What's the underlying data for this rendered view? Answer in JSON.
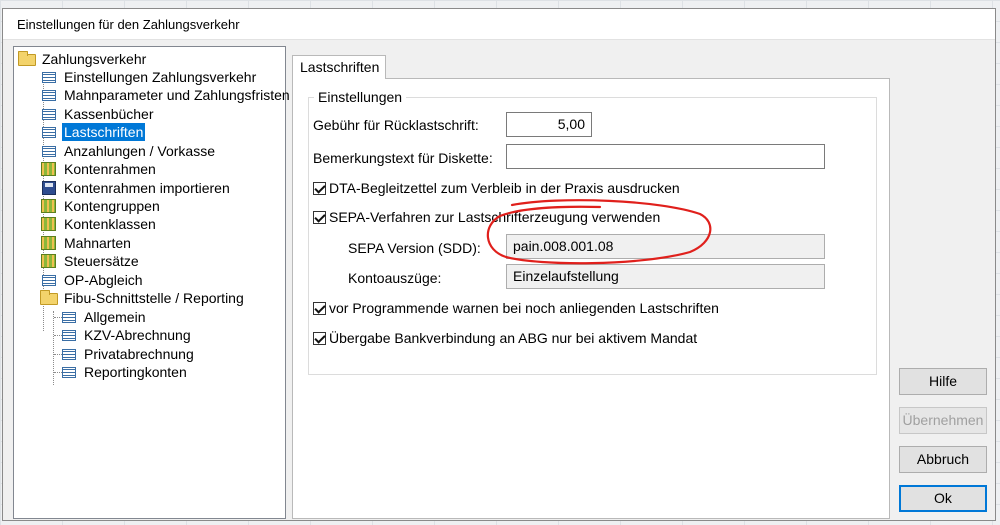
{
  "window": {
    "title": "Einstellungen für den Zahlungsverkehr"
  },
  "tree": {
    "root": "Zahlungsverkehr",
    "items": [
      {
        "label": "Einstellungen Zahlungsverkehr",
        "icon": "list-icon"
      },
      {
        "label": "Mahnparameter und Zahlungsfristen",
        "icon": "list-icon"
      },
      {
        "label": "Kassenbücher",
        "icon": "list-icon"
      },
      {
        "label": "Lastschriften",
        "icon": "list-icon",
        "selected": true
      },
      {
        "label": "Anzahlungen / Vorkasse",
        "icon": "list-icon"
      },
      {
        "label": "Kontenrahmen",
        "icon": "books-icon"
      },
      {
        "label": "Kontenrahmen importieren",
        "icon": "disk-icon"
      },
      {
        "label": "Kontengruppen",
        "icon": "books-icon"
      },
      {
        "label": "Kontenklassen",
        "icon": "books-icon"
      },
      {
        "label": "Mahnarten",
        "icon": "books-icon"
      },
      {
        "label": "Steuersätze",
        "icon": "books-icon"
      },
      {
        "label": "OP-Abgleich",
        "icon": "list-icon"
      },
      {
        "label": "Fibu-Schnittstelle / Reporting",
        "icon": "folder-open-icon"
      }
    ],
    "sub_items": [
      {
        "label": "Allgemein"
      },
      {
        "label": "KZV-Abrechnung"
      },
      {
        "label": "Privatabrechnung"
      },
      {
        "label": "Reportingkonten"
      }
    ]
  },
  "tab": {
    "label": "Lastschriften"
  },
  "group": {
    "legend": "Einstellungen"
  },
  "form": {
    "fee_label": "Gebühr für Rücklastschrift:",
    "fee_value": "5,00",
    "remark_label": "Bemerkungstext für Diskette:",
    "remark_value": "",
    "dta_label": "DTA-Begleitzettel zum Verbleib in der Praxis ausdrucken",
    "dta_checked": true,
    "sepa_label": "SEPA-Verfahren zur Lastschrifterzeugung verwenden",
    "sepa_checked": true,
    "sepa_version_label": "SEPA Version (SDD):",
    "sepa_version_value": "pain.008.001.08",
    "statement_label": "Kontoauszüge:",
    "statement_value": "Einzelaufstellung",
    "warn_label": "vor Programmende warnen bei noch anliegenden Lastschriften",
    "warn_checked": true,
    "transfer_label": "Übergabe Bankverbindung an ABG nur bei aktivem Mandat",
    "transfer_checked": true
  },
  "buttons": {
    "help": "Hilfe",
    "apply": "Übernehmen",
    "cancel": "Abbruch",
    "ok": "Ok"
  },
  "colors": {
    "selection": "#0078d7",
    "annotation": "#e0201c"
  }
}
